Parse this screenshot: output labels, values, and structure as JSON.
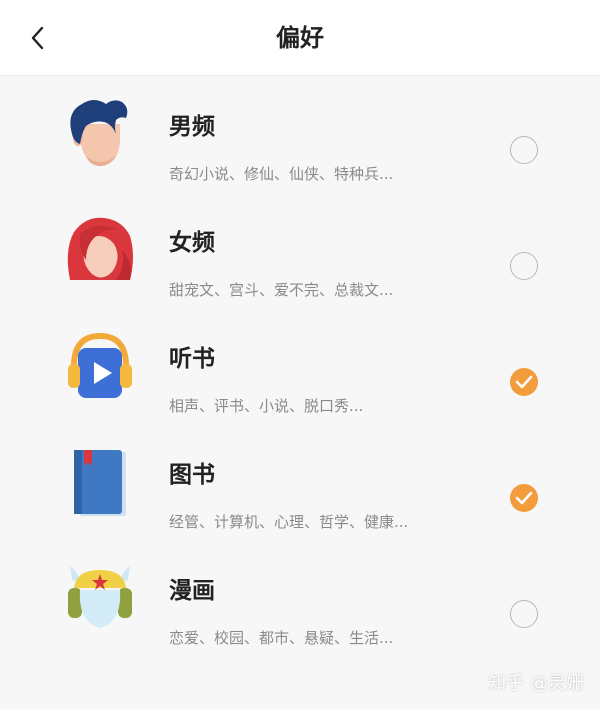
{
  "header": {
    "title": "偏好",
    "back_icon": "chevron-left-icon"
  },
  "colors": {
    "accent": "#f39c3c",
    "radio_border": "#b9b9b9"
  },
  "preferences": [
    {
      "title": "男频",
      "description": "奇幻小说、修仙、仙侠、特种兵...",
      "icon": "male-avatar-icon",
      "selected": false
    },
    {
      "title": "女频",
      "description": "甜宠文、宫斗、爱不完、总裁文...",
      "icon": "female-avatar-icon",
      "selected": false
    },
    {
      "title": "听书",
      "description": "相声、评书、小说、脱口秀...",
      "icon": "headphones-play-icon",
      "selected": true
    },
    {
      "title": "图书",
      "description": "经管、计算机、心理、哲学、健康...",
      "icon": "book-icon",
      "selected": true
    },
    {
      "title": "漫画",
      "description": "恋爱、校园、都市、悬疑、生活...",
      "icon": "comic-character-icon",
      "selected": false
    }
  ],
  "watermark": "知乎 @灵姗"
}
